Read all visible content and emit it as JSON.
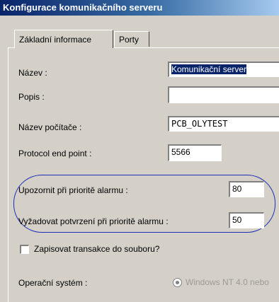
{
  "window": {
    "title": "Konfigurace komunikačního serveru"
  },
  "tabs": [
    {
      "label": "Základní informace",
      "active": true
    },
    {
      "label": "Porty",
      "active": false
    }
  ],
  "form": {
    "name": {
      "label": "Název :",
      "value": "Komunikační server"
    },
    "description": {
      "label": "Popis :",
      "value": ""
    },
    "computer_name": {
      "label": "Název počítače :",
      "value": "PCB_OLYTEST"
    },
    "protocol_end_point": {
      "label": "Protocol end point :",
      "value": "5566"
    },
    "alarm_notify_priority": {
      "label": "Upozornit při prioritě alarmu :",
      "value": "80"
    },
    "alarm_ack_priority": {
      "label": "Vyžadovat potvrzení při prioritě alarmu :",
      "value": "50"
    },
    "log_transactions": {
      "label": "Zapisovat transakce do souboru?",
      "checked": false
    },
    "os": {
      "label": "Operační systém :",
      "option": "Windows NT 4.0 nebo"
    }
  }
}
